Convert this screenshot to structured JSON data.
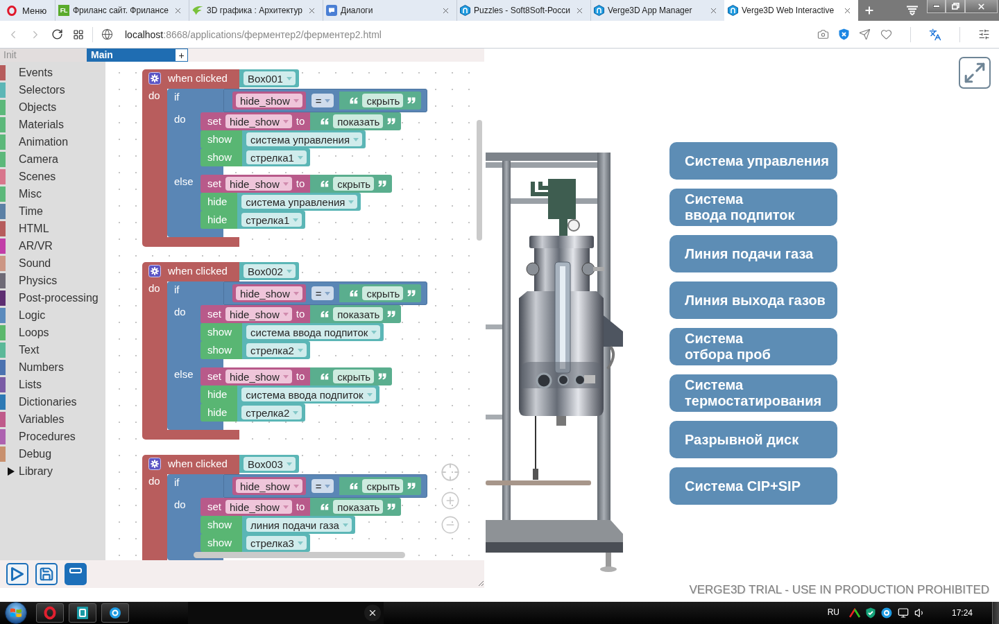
{
  "browser": {
    "menu_button": "Меню",
    "tabs": [
      {
        "kind": "fl",
        "badge": "FL",
        "title": "Фриланс сайт. Фрилансе",
        "selected": false
      },
      {
        "kind": "leaf",
        "title": "3D графика : Архитектур",
        "selected": false
      },
      {
        "kind": "chat",
        "title": "Диалоги",
        "selected": false
      },
      {
        "kind": "verge",
        "title": "Puzzles - Soft8Soft-Росси",
        "selected": false
      },
      {
        "kind": "verge",
        "title": "Verge3D App Manager",
        "selected": false
      },
      {
        "kind": "verge",
        "title": "Verge3D Web Interactive",
        "selected": true
      }
    ],
    "navigation": {
      "back": {
        "disabled": true
      },
      "forward": {
        "disabled": true
      }
    },
    "address": {
      "host": "localhost",
      "path": ":8668/applications/ферментер2/ферментер2.html"
    }
  },
  "editor": {
    "tabs": [
      {
        "label": "Init",
        "selected": false
      },
      {
        "label": "Main",
        "selected": true
      }
    ],
    "add_tab_label": "+",
    "toolbox": [
      {
        "label": "Events",
        "color": "#b65c5c"
      },
      {
        "label": "Selectors",
        "color": "#5cb6b6"
      },
      {
        "label": "Objects",
        "color": "#5cb87a"
      },
      {
        "label": "Materials",
        "color": "#5cb87a"
      },
      {
        "label": "Animation",
        "color": "#5cb87a"
      },
      {
        "label": "Camera",
        "color": "#5cb87a"
      },
      {
        "label": "Scenes",
        "color": "#d8768c"
      },
      {
        "label": "Misc",
        "color": "#5cb87a"
      },
      {
        "label": "Time",
        "color": "#5b80a5"
      },
      {
        "label": "HTML",
        "color": "#b65c5c"
      },
      {
        "label": "AR/VR",
        "color": "#c23ea8"
      },
      {
        "label": "Sound",
        "color": "#cc9684"
      },
      {
        "label": "Physics",
        "color": "#6e6a76"
      },
      {
        "label": "Post-processing",
        "color": "#5e2f72"
      },
      {
        "label": "Logic",
        "color": "#5b8bbd"
      },
      {
        "label": "Loops",
        "color": "#5bb86c"
      },
      {
        "label": "Text",
        "color": "#5bb898"
      },
      {
        "label": "Numbers",
        "color": "#4b72b0"
      },
      {
        "label": "Lists",
        "color": "#7a5ba5"
      },
      {
        "label": "Dictionaries",
        "color": "#2d79b4"
      },
      {
        "label": "Variables",
        "color": "#bf5a8a"
      },
      {
        "label": "Procedures",
        "color": "#ad62b0"
      },
      {
        "label": "Debug",
        "color": "#c8906e"
      },
      {
        "label": "Library",
        "expanded": false
      }
    ],
    "blocks": [
      {
        "kind": "event",
        "label": "when clicked",
        "object": "Box001",
        "do_label": "do",
        "statements": [
          {
            "kind": "if_else",
            "label": "if",
            "condition": {
              "variable": "hide_show",
              "operator": "=",
              "value": "скрыть"
            },
            "do_label": "do",
            "do": [
              {
                "kind": "set",
                "label": "set",
                "variable": "hide_show",
                "to_label": "to",
                "value": "показать"
              },
              {
                "kind": "visibility",
                "label": "show",
                "object": "система управления"
              },
              {
                "kind": "visibility",
                "label": "show",
                "object": "стрелка1"
              }
            ],
            "else_label": "else",
            "else": [
              {
                "kind": "set",
                "label": "set",
                "variable": "hide_show",
                "to_label": "to",
                "value": "скрыть"
              },
              {
                "kind": "visibility",
                "label": "hide",
                "object": "система управления"
              },
              {
                "kind": "visibility",
                "label": "hide",
                "object": "стрелка1"
              }
            ]
          }
        ]
      },
      {
        "kind": "event",
        "label": "when clicked",
        "object": "Box002",
        "do_label": "do",
        "statements": [
          {
            "kind": "if_else",
            "label": "if",
            "condition": {
              "variable": "hide_show",
              "operator": "=",
              "value": "скрыть"
            },
            "do_label": "do",
            "do": [
              {
                "kind": "set",
                "label": "set",
                "variable": "hide_show",
                "to_label": "to",
                "value": "показать"
              },
              {
                "kind": "visibility",
                "label": "show",
                "object": "система ввода подпиток"
              },
              {
                "kind": "visibility",
                "label": "show",
                "object": "стрелка2"
              }
            ],
            "else_label": "else",
            "else": [
              {
                "kind": "set",
                "label": "set",
                "variable": "hide_show",
                "to_label": "to",
                "value": "скрыть"
              },
              {
                "kind": "visibility",
                "label": "hide",
                "object": "система ввода подпиток"
              },
              {
                "kind": "visibility",
                "label": "hide",
                "object": "стрелка2"
              }
            ]
          }
        ]
      },
      {
        "kind": "event",
        "label": "when clicked",
        "object": "Box003",
        "do_label": "do",
        "statements": [
          {
            "kind": "if_else",
            "label": "if",
            "condition": {
              "variable": "hide_show",
              "operator": "=",
              "value": "скрыть"
            },
            "do_label": "do",
            "do": [
              {
                "kind": "set",
                "label": "set",
                "variable": "hide_show",
                "to_label": "to",
                "value": "показать"
              },
              {
                "kind": "visibility",
                "label": "show",
                "object": "линия подачи газа"
              },
              {
                "kind": "visibility",
                "label": "show",
                "object": "стрелка3"
              }
            ]
          }
        ]
      }
    ]
  },
  "scene": {
    "labels": [
      "Система управления",
      "Система\nввода подпиток",
      "Линия подачи газа",
      "Линия выхода газов",
      "Система\nотбора проб",
      "Система\nтермостатирования",
      "Разрывной диск",
      "Система CIP+SIP"
    ],
    "trial_notice": "VERGE3D TRIAL - USE IN PRODUCTION PROHIBITED"
  },
  "taskbar": {
    "language": "RU",
    "time": "17:24"
  }
}
